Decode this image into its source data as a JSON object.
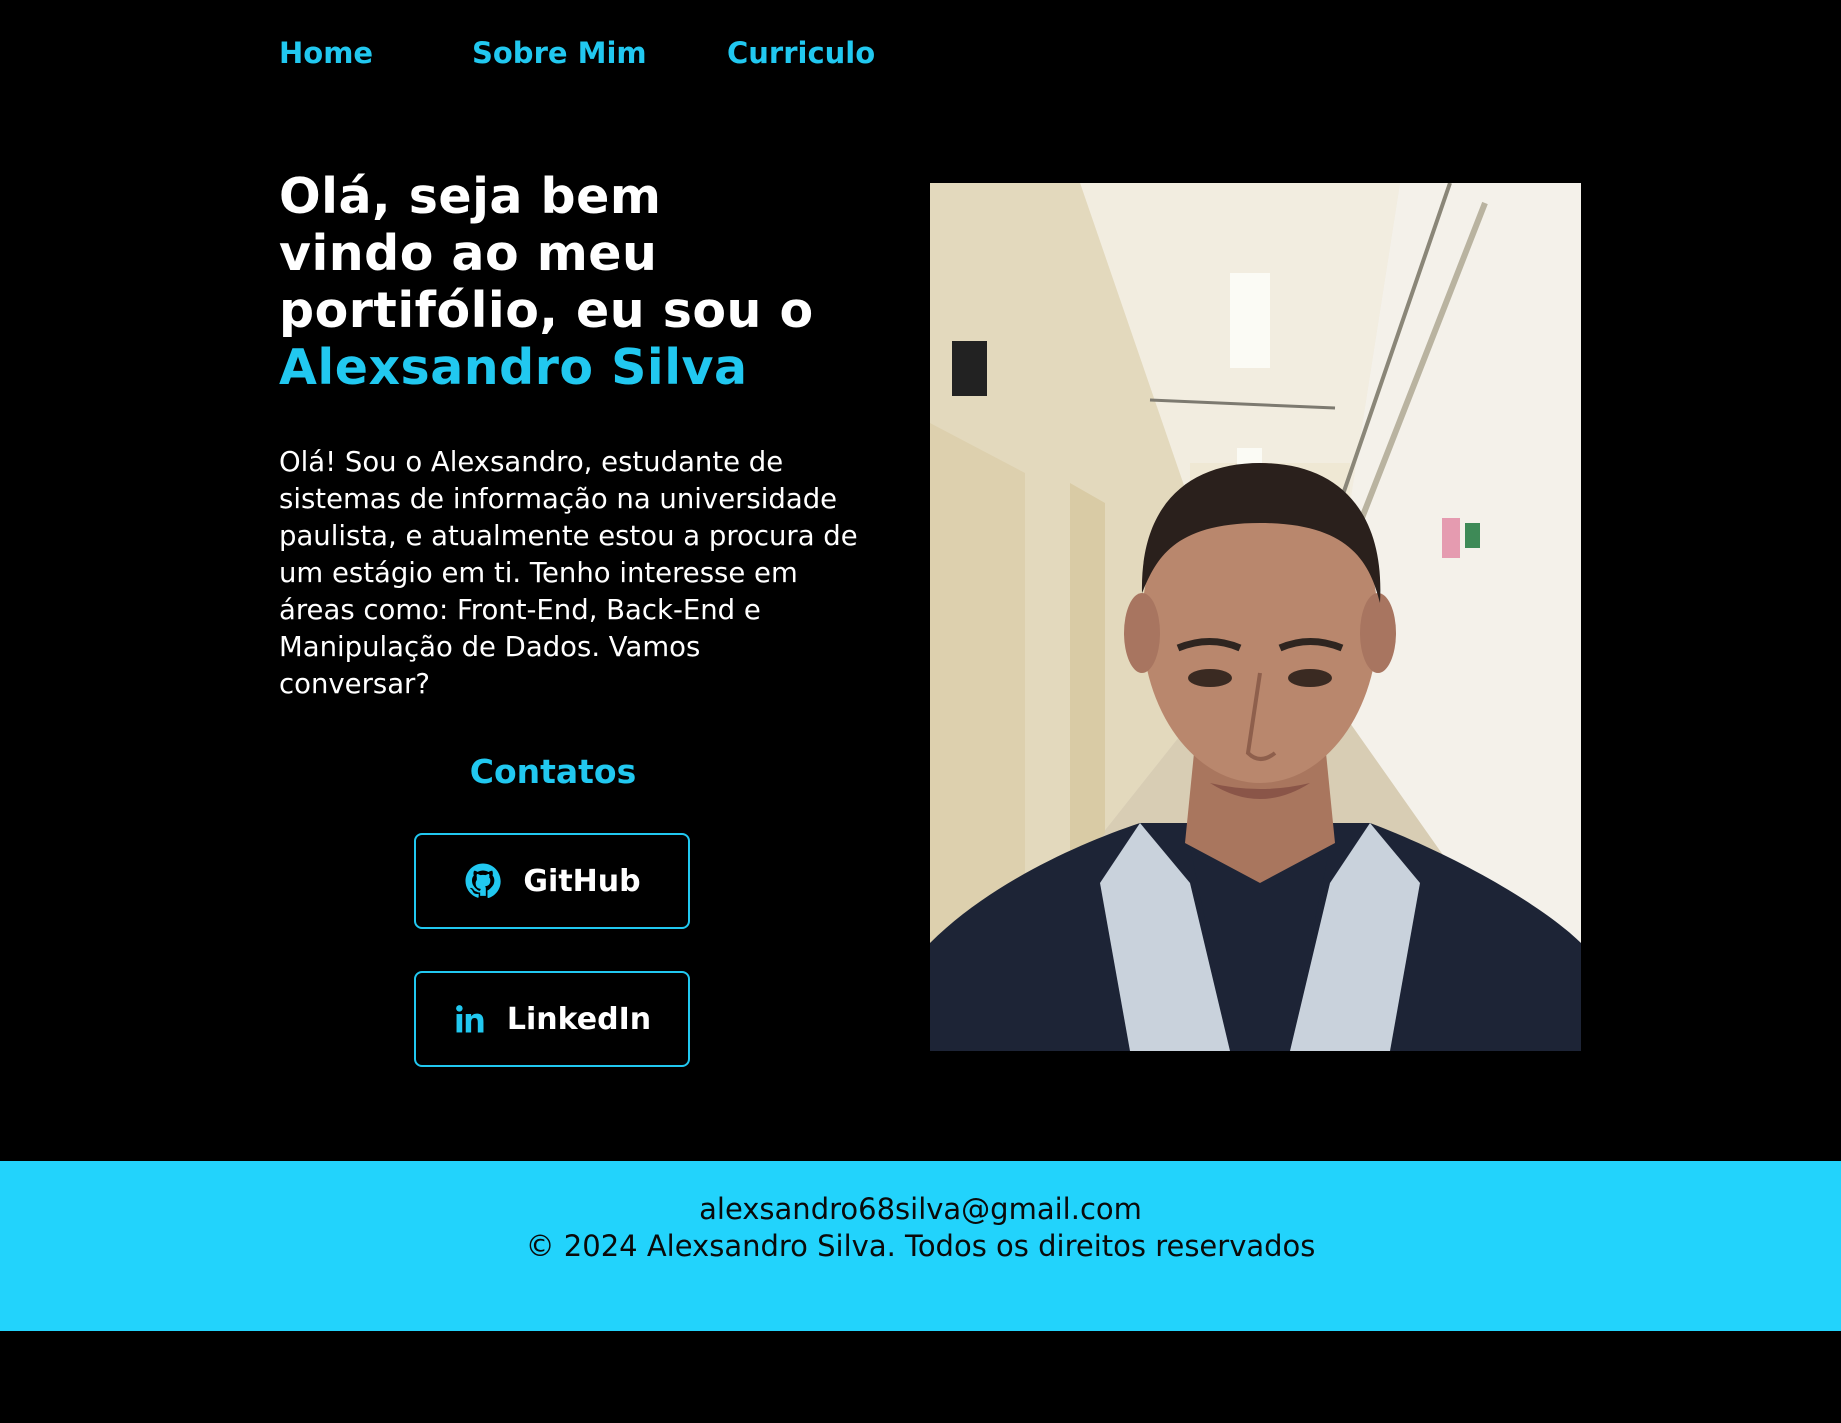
{
  "nav": {
    "items": [
      {
        "label": "Home"
      },
      {
        "label": "Sobre Mim"
      },
      {
        "label": "Curriculo"
      }
    ]
  },
  "hero": {
    "title_lines": [
      "Olá, seja bem",
      "vindo ao meu",
      "portifólio, eu sou o"
    ],
    "name": "Alexsandro Silva",
    "bio": "Olá! Sou o Alexsandro, estudante de sistemas de informação na universidade paulista, e atualmente estou a procura de um estágio em ti. Tenho interesse em áreas como: Front-End, Back-End e Manipulação de Dados. Vamos conversar?"
  },
  "contacts": {
    "title": "Contatos",
    "github": {
      "label": "GitHub",
      "icon": "github-icon"
    },
    "linkedin": {
      "label": "LinkedIn",
      "icon": "linkedin-icon"
    }
  },
  "footer": {
    "email": "alexsandro68silva@gmail.com",
    "copyright": "© 2024 Alexsandro Silva. Todos os direitos reservados"
  },
  "colors": {
    "accent": "#21c8f0",
    "footer_bg": "#22d3fc",
    "background": "#000000",
    "text": "#ffffff"
  }
}
